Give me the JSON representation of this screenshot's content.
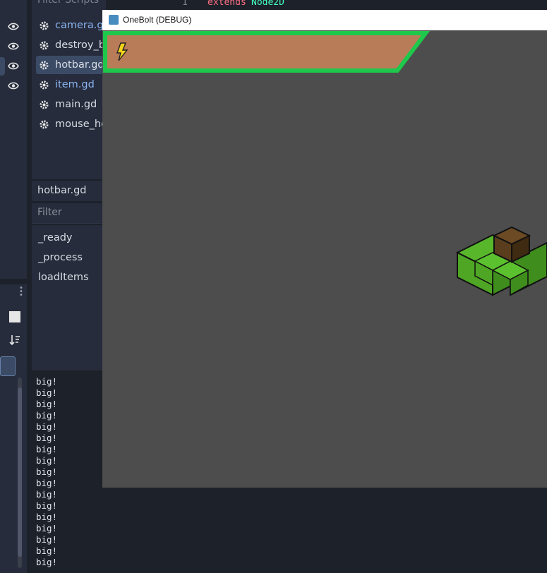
{
  "script_panel": {
    "filter_placeholder": "Filter Scripts",
    "scripts": [
      {
        "name": "camera.gd",
        "modified": true
      },
      {
        "name": "destroy_bl",
        "modified": false
      },
      {
        "name": "hotbar.gd",
        "modified": false,
        "selected": true
      },
      {
        "name": "item.gd",
        "modified": true
      },
      {
        "name": "main.gd",
        "modified": false
      },
      {
        "name": "mouse_ho",
        "modified": false
      }
    ],
    "current_script": "hotbar.gd",
    "filter_methods_placeholder": "Filter Methods",
    "methods": [
      "_ready",
      "_process",
      "loadItems"
    ]
  },
  "code_editor": {
    "line_number": "1",
    "keyword": "extends",
    "type": "Node2D"
  },
  "game_window": {
    "title": "OneBolt (DEBUG)"
  },
  "output": {
    "lines": [
      "big!",
      "big!",
      "big!",
      "big!",
      "big!",
      "big!",
      "big!",
      "big!",
      "big!",
      "big!",
      "big!",
      "big!",
      "big!",
      "big!",
      "big!",
      "big!",
      "big!"
    ]
  },
  "colors": {
    "editor_bg": "#1d2129",
    "panel_bg": "#262c3b",
    "selection": "#3b4b66",
    "game_bg": "#4d4d4d",
    "hotbar_fill": "#b97c59",
    "hotbar_border": "#1ec84b",
    "keyword": "#ff7085",
    "type": "#42ffc2"
  },
  "icons": {
    "eye": "eye-icon",
    "gear": "gear-icon",
    "search": "search-icon",
    "bolt": "lightning-bolt-icon",
    "godot": "godot-icon"
  }
}
